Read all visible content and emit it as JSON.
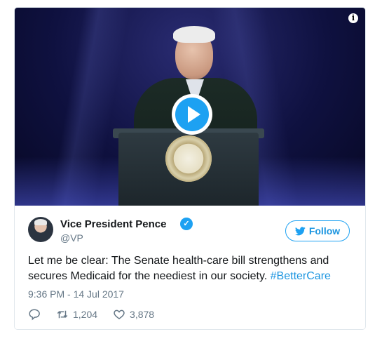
{
  "media": {
    "info_icon": "info-icon",
    "play_icon": "play-icon"
  },
  "tweet": {
    "display_name": "Vice President Pence",
    "handle": "@VP",
    "follow_label": "Follow",
    "text_main": "Let me be clear: The Senate health-care bill strengthens and secures Medicaid for the neediest in our society. ",
    "hashtag": "#BetterCare",
    "timestamp": "9:36 PM - 14 Jul 2017",
    "retweets": "1,204",
    "likes": "3,878"
  },
  "colors": {
    "accent": "#1da1f2",
    "link": "#1b95e0",
    "muted": "#657786",
    "text": "#14171a",
    "border": "#e1e8ed"
  }
}
